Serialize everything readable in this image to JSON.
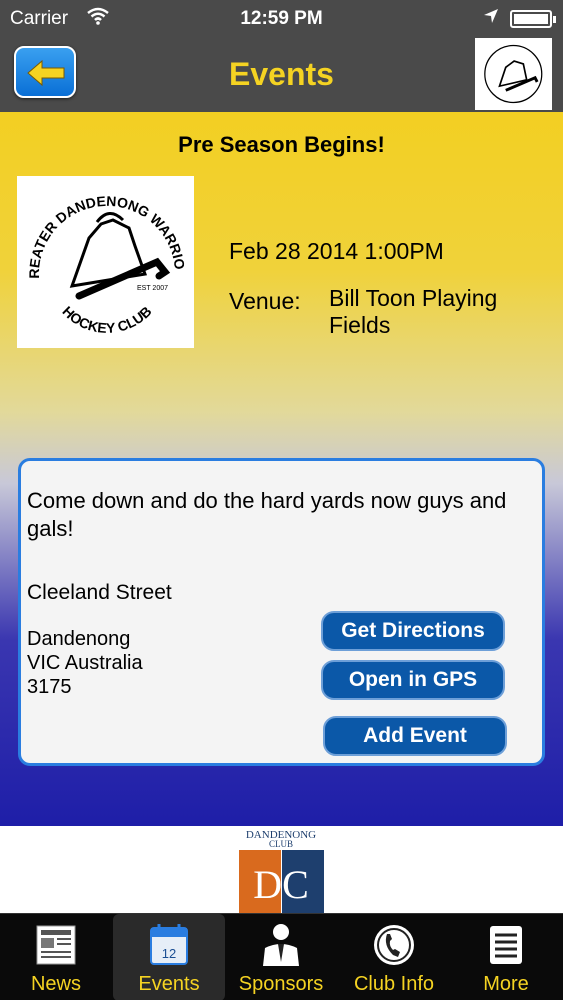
{
  "status_bar": {
    "carrier": "Carrier",
    "time": "12:59 PM"
  },
  "nav": {
    "title": "Events",
    "back_icon": "arrow-left-icon"
  },
  "event": {
    "title": "Pre Season Begins!",
    "date": "Feb 28 2014  1:00PM",
    "venue_label": "Venue:",
    "venue": "Bill Toon Playing Fields",
    "description": "Come down and do the hard yards now guys and gals!",
    "street": "Cleeland Street",
    "suburb": "Dandenong",
    "state_country": "VIC Australia",
    "postcode": "3175"
  },
  "club_logo": {
    "top_text": "GREATER DANDENONG WARRIORS",
    "bottom_text": "HOCKEY CLUB",
    "est": "EST 2007"
  },
  "buttons": {
    "directions": "Get Directions",
    "gps": "Open in GPS",
    "add_event": "Add Event"
  },
  "ad": {
    "top_text": "DANDENONG",
    "sub_text": "CLUB",
    "letters": "DC"
  },
  "tabs": [
    {
      "label": "News",
      "icon": "newspaper-icon"
    },
    {
      "label": "Events",
      "icon": "calendar-icon",
      "badge": "12"
    },
    {
      "label": "Sponsors",
      "icon": "person-suit-icon"
    },
    {
      "label": "Club Info",
      "icon": "phone-icon"
    },
    {
      "label": "More",
      "icon": "list-icon"
    }
  ],
  "colors": {
    "accent_yellow": "#f5d322",
    "button_blue": "#0b58a8",
    "card_border": "#2a7de0",
    "nav_gray": "#4a4a4a"
  }
}
